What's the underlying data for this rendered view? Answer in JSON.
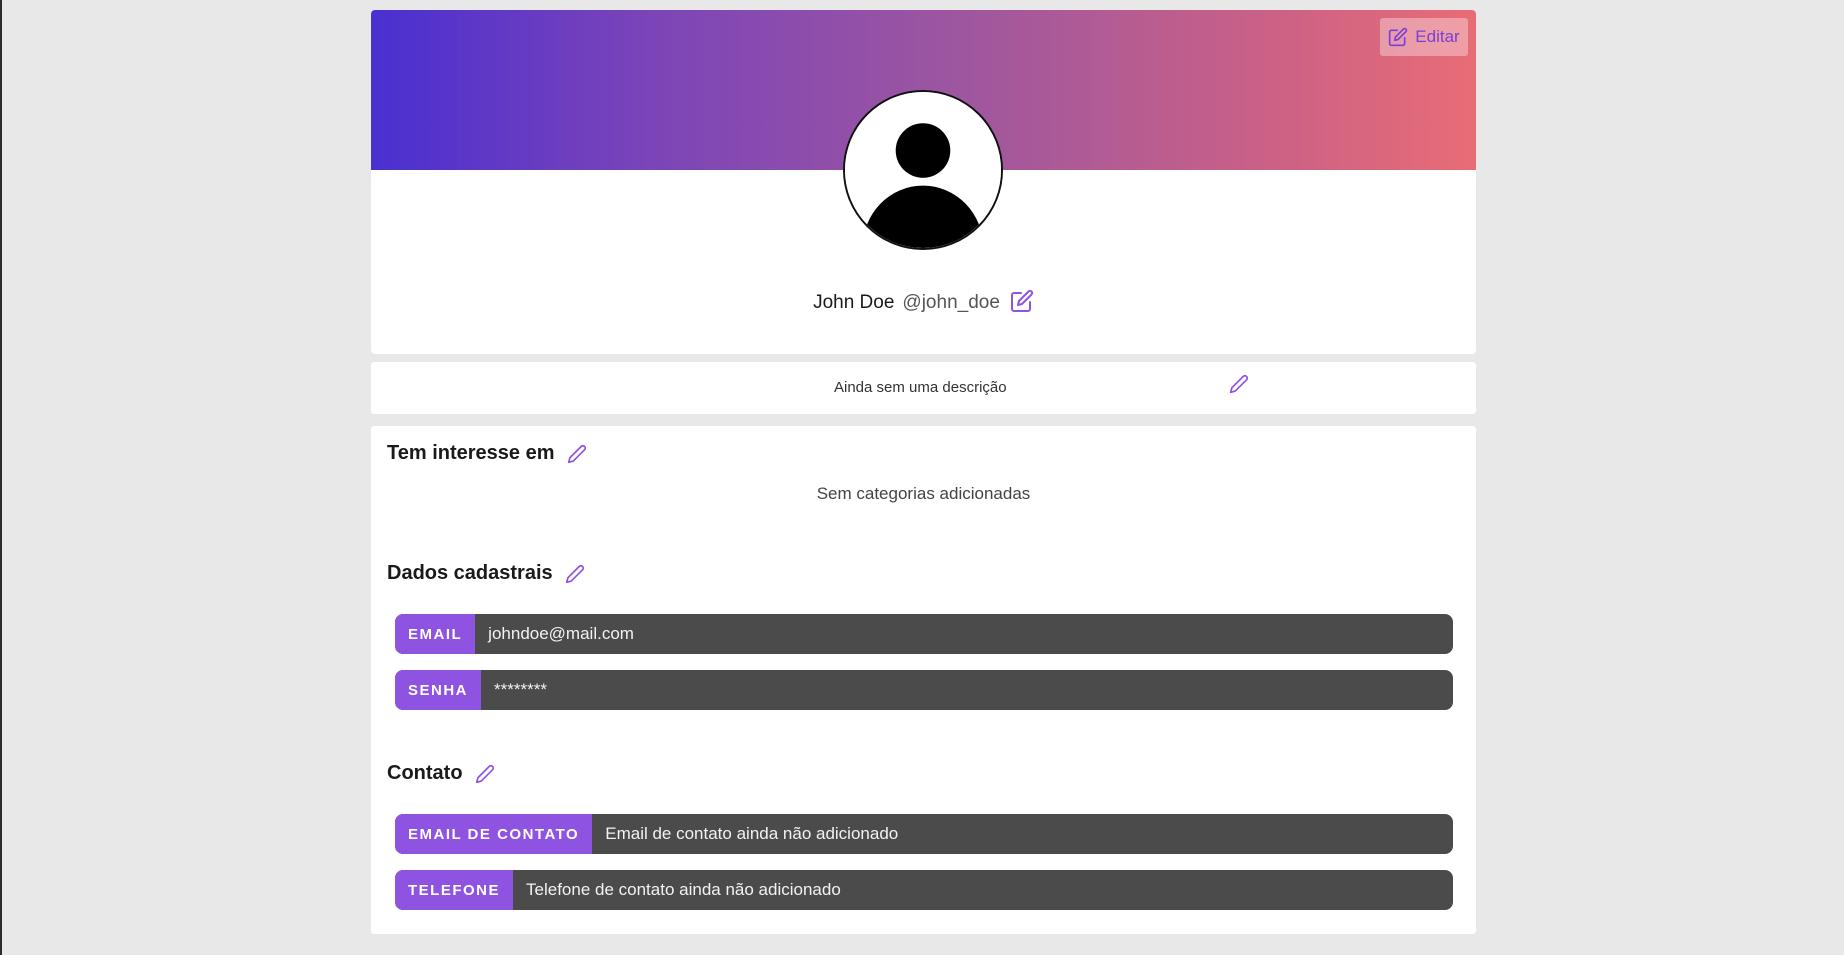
{
  "header": {
    "edit_label": "Editar"
  },
  "profile": {
    "name": "John Doe",
    "handle": "@john_doe"
  },
  "description": {
    "text": "Ainda sem uma descrição"
  },
  "interests": {
    "title": "Tem interesse em",
    "empty_text": "Sem categorias adicionadas"
  },
  "registration": {
    "title": "Dados cadastrais",
    "fields": [
      {
        "label": "EMAIL",
        "value": "johndoe@mail.com"
      },
      {
        "label": "SENHA",
        "value": "********"
      }
    ]
  },
  "contact": {
    "title": "Contato",
    "fields": [
      {
        "label": "EMAIL DE CONTATO",
        "value": "Email de contato ainda não adicionado"
      },
      {
        "label": "TELEFONE",
        "value": "Telefone de contato ainda não adicionado"
      }
    ]
  },
  "colors": {
    "accent": "#8e53e0",
    "banner_start": "#4a2fd1",
    "banner_end": "#e86c76",
    "field_bg": "#4b4b4b"
  },
  "icons": {
    "edit": "edit-square-icon",
    "pencil": "pencil-icon",
    "avatar": "user-avatar-icon"
  }
}
